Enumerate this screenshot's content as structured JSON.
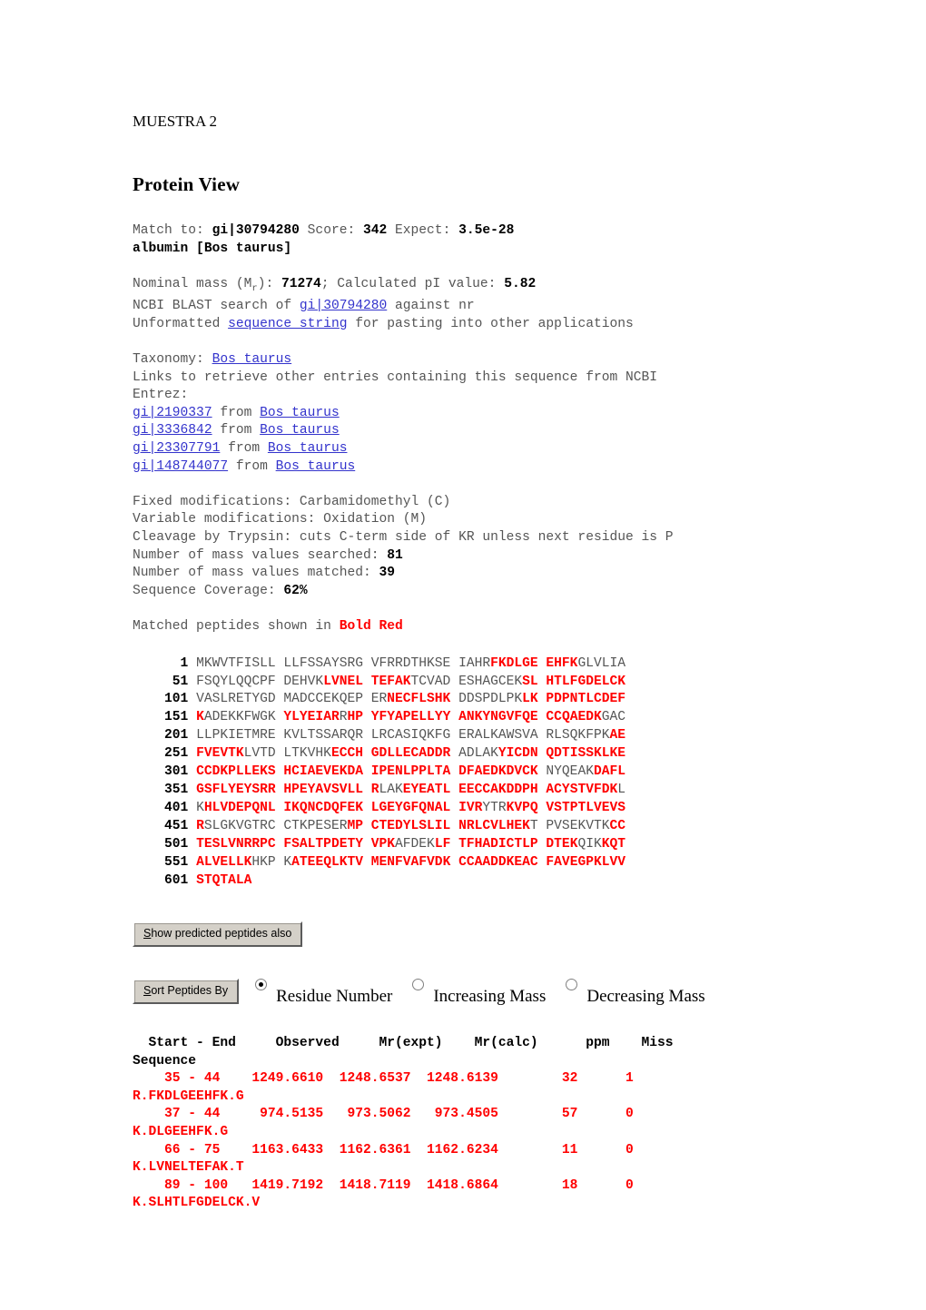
{
  "document": {
    "heading": "MUESTRA 2",
    "title": "Protein View"
  },
  "match": {
    "label_match_to": "Match to: ",
    "accession": "gi|30794280",
    "label_score": " Score: ",
    "score": "342",
    "label_expect": " Expect: ",
    "expect": "3.5e-28",
    "description": "albumin [Bos taurus]"
  },
  "properties": {
    "nominal_mass_label": "Nominal mass (M",
    "nominal_mass_sub": "r",
    "nominal_mass_label_end": "): ",
    "nominal_mass": "71274",
    "pi_label": "; Calculated pI value: ",
    "pi_value": "5.82",
    "blast_prefix": "NCBI BLAST search of ",
    "blast_link": "gi|30794280",
    "blast_suffix": " against nr",
    "unformatted_prefix": "Unformatted ",
    "unformatted_link": "sequence string",
    "unformatted_suffix": " for pasting into other applications"
  },
  "taxonomy": {
    "label": "Taxonomy: ",
    "organism": "Bos taurus",
    "links_note_line1": "Links to retrieve other entries containing this sequence from NCBI",
    "links_note_line2": "Entrez:",
    "entries": [
      {
        "gi": "gi|2190337",
        "from": " from ",
        "organism": "Bos taurus"
      },
      {
        "gi": "gi|3336842",
        "from": " from ",
        "organism": "Bos taurus"
      },
      {
        "gi": "gi|23307791",
        "from": " from ",
        "organism": "Bos taurus"
      },
      {
        "gi": "gi|148744077",
        "from": " from ",
        "organism": "Bos taurus"
      }
    ]
  },
  "search_params": {
    "fixed_modifications": "Fixed modifications: Carbamidomethyl (C)",
    "variable_modifications": "Variable modifications: Oxidation (M)",
    "cleavage": "Cleavage by Trypsin: cuts C-term side of KR unless next residue is P",
    "mass_values_searched_label": "Number of mass values searched: ",
    "mass_values_searched": "81",
    "mass_values_matched_label": "Number of mass values matched: ",
    "mass_values_matched": "39",
    "sequence_coverage_label": "Sequence Coverage: ",
    "sequence_coverage": "62%"
  },
  "legend": {
    "prefix": "Matched peptides shown in ",
    "bold_red": "Bold Red",
    "color": "#ff0000"
  },
  "sequence": {
    "rows": [
      {
        "num": "  1",
        "segments": [
          {
            "t": "MKWVTFISLL LLFSSAYSRG VFRRDTHKSE IAHR",
            "m": false
          },
          {
            "t": "FKDLGE EHFK",
            "m": true
          },
          {
            "t": "GLVLIA",
            "m": false
          }
        ]
      },
      {
        "num": " 51",
        "segments": [
          {
            "t": "FSQYLQQCPF DEHVK",
            "m": false
          },
          {
            "t": "LVNEL TEFAK",
            "m": true
          },
          {
            "t": "TCVAD ESHAGCEK",
            "m": false
          },
          {
            "t": "SL HTLFGDELCK",
            "m": true
          }
        ]
      },
      {
        "num": "101",
        "segments": [
          {
            "t": "VASLRETYGD MADCCEKQEP ER",
            "m": false
          },
          {
            "t": "NECFLSHK",
            "m": true
          },
          {
            "t": " DDSPDLPK",
            "m": false
          },
          {
            "t": "LK PDPNTLCDEF",
            "m": true
          }
        ]
      },
      {
        "num": "151",
        "segments": [
          {
            "t": "K",
            "m": true
          },
          {
            "t": "ADEKKFWGK ",
            "m": false
          },
          {
            "t": "YLYEIAR",
            "m": true
          },
          {
            "t": "R",
            "m": false
          },
          {
            "t": "HP YFYAPELLYY ANKYNGVFQE CCQAEDK",
            "m": true
          },
          {
            "t": "GAC",
            "m": false
          }
        ]
      },
      {
        "num": "201",
        "segments": [
          {
            "t": "LLPKIETMRE KVLTSSARQR LRCASIQKFG ERALKAWSVA RLSQKFPK",
            "m": false
          },
          {
            "t": "AE",
            "m": true
          }
        ]
      },
      {
        "num": "251",
        "segments": [
          {
            "t": "FVEVTK",
            "m": true
          },
          {
            "t": "LVTD LTKVHK",
            "m": false
          },
          {
            "t": "ECCH GDLLECADDR",
            "m": true
          },
          {
            "t": " ADLAK",
            "m": false
          },
          {
            "t": "YICDN QDTISSKLKE",
            "m": true
          }
        ]
      },
      {
        "num": "301",
        "segments": [
          {
            "t": "CCDKPLLEKS HCIAEVEKDA IPENLPPLTA DFAEDKDVCK",
            "m": true
          },
          {
            "t": " NYQEAK",
            "m": false
          },
          {
            "t": "DAFL",
            "m": true
          }
        ]
      },
      {
        "num": "351",
        "segments": [
          {
            "t": "GSFLYEYSRR HPEYAVSVLL R",
            "m": true
          },
          {
            "t": "LAK",
            "m": false
          },
          {
            "t": "EYEATL EECCAKDDPH ACYSTVFDK",
            "m": true
          },
          {
            "t": "L",
            "m": false
          }
        ]
      },
      {
        "num": "401",
        "segments": [
          {
            "t": "K",
            "m": false
          },
          {
            "t": "HLVDEPQNL IKQNCDQFEK LGEYGFQNAL IVR",
            "m": true
          },
          {
            "t": "YTR",
            "m": false
          },
          {
            "t": "KVPQ VSTPTLVEVS",
            "m": true
          }
        ]
      },
      {
        "num": "451",
        "segments": [
          {
            "t": "R",
            "m": true
          },
          {
            "t": "SLGKVGTRC CTKPESER",
            "m": false
          },
          {
            "t": "MP CTEDYLSLIL NRLCVLHEK",
            "m": true
          },
          {
            "t": "T PVSEKVTK",
            "m": false
          },
          {
            "t": "CC",
            "m": true
          }
        ]
      },
      {
        "num": "501",
        "segments": [
          {
            "t": "TESLVNRRPC FSALTPDETY VPK",
            "m": true
          },
          {
            "t": "AFDEK",
            "m": false
          },
          {
            "t": "LF TFHADICTLP DTEK",
            "m": true
          },
          {
            "t": "QIK",
            "m": false
          },
          {
            "t": "KQT",
            "m": true
          }
        ]
      },
      {
        "num": "551",
        "segments": [
          {
            "t": "ALVELLK",
            "m": true
          },
          {
            "t": "HKP K",
            "m": false
          },
          {
            "t": "ATEEQLKTV MENFVAFVDK CCAADDKEAC FAVEGPKLVV",
            "m": true
          }
        ]
      },
      {
        "num": "601",
        "segments": [
          {
            "t": "STQTALA",
            "m": true
          }
        ]
      }
    ]
  },
  "controls": {
    "show_predicted_accesskey": "S",
    "show_predicted_rest": "how predicted peptides also",
    "sort_accesskey": "S",
    "sort_rest": "ort Peptides By",
    "radios": [
      {
        "label": "Residue Number",
        "checked": true
      },
      {
        "label": "Increasing Mass",
        "checked": false
      },
      {
        "label": "Decreasing Mass",
        "checked": false
      }
    ]
  },
  "peptide_table": {
    "header_line1": "  Start - End     Observed     Mr(expt)    Mr(calc)      ppm    Miss",
    "header_line2": "Sequence",
    "rows": [
      {
        "line1": "    35 - 44    1249.6610  1248.6537  1248.6139        32      1",
        "line2": "R.FKDLGEEHFK.G"
      },
      {
        "line1": "    37 - 44     974.5135   973.5062   973.4505        57      0",
        "line2": "K.DLGEEHFK.G"
      },
      {
        "line1": "    66 - 75    1163.6433  1162.6361  1162.6234        11      0",
        "line2": "K.LVNELTEFAK.T"
      },
      {
        "line1": "    89 - 100   1419.7192  1418.7119  1418.6864        18      0",
        "line2": "K.SLHTLFGDELCK.V"
      }
    ]
  }
}
